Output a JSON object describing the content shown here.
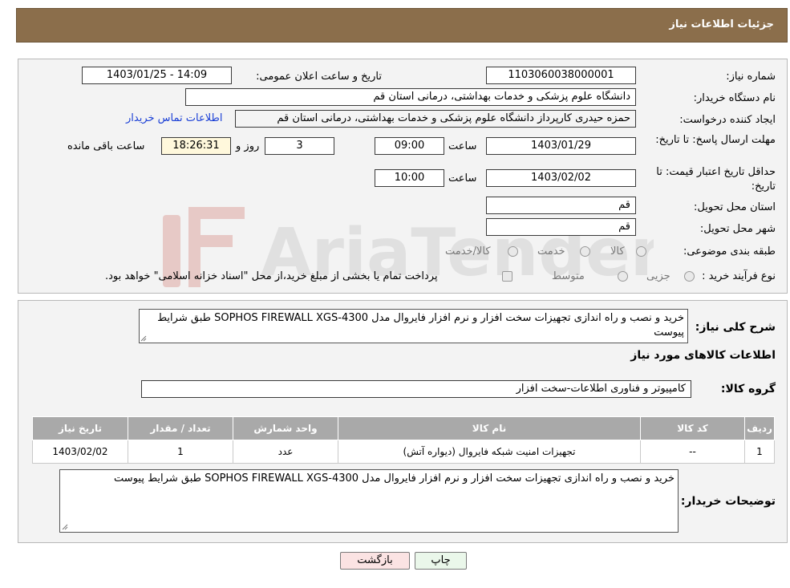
{
  "header": {
    "title": "جزئیات اطلاعات نیاز"
  },
  "fields": {
    "need_number_label": "شماره نیاز:",
    "need_number": "1103060038000001",
    "announce_label": "تاریخ و ساعت اعلان عمومی:",
    "announce_value": "1403/01/25 - 14:09",
    "buyer_org_label": "نام دستگاه خریدار:",
    "buyer_org": "دانشگاه علوم پزشکی و خدمات بهداشتی، درمانی استان قم",
    "creator_label": "ایجاد کننده درخواست:",
    "creator": "حمزه حیدری کارپرداز دانشگاه علوم پزشکی و خدمات بهداشتی، درمانی استان قم",
    "contact_link": "اطلاعات تماس خریدار",
    "deadline_label": "مهلت ارسال پاسخ: تا تاریخ:",
    "deadline_date": "1403/01/29",
    "time_label": "ساعت",
    "deadline_time": "09:00",
    "days_value": "3",
    "days_label": "روز و",
    "remaining_time": "18:26:31",
    "remaining_label": "ساعت باقی مانده",
    "validity_label": "حداقل تاریخ اعتبار قیمت: تا تاریخ:",
    "validity_date": "1403/02/02",
    "validity_time": "10:00",
    "province_label": "استان محل تحویل:",
    "province": "قم",
    "city_label": "شهر محل تحویل:",
    "city": "قم",
    "category_label": "طبقه بندی موضوعی:",
    "category_options": [
      "کالا",
      "خدمت",
      "کالا/خدمت"
    ],
    "process_label": "نوع فرآیند خرید :",
    "process_options": [
      "جزیی",
      "متوسط"
    ],
    "process_note": "پرداخت تمام یا بخشی از مبلغ خرید،از محل \"اسناد خزانه اسلامی\" خواهد بود."
  },
  "details": {
    "summary_label": "شرح کلی نیاز:",
    "summary": "خرید و نصب و راه اندازی تجهیزات سخت افزار و نرم افزار فایروال مدل SOPHOS FIREWALL XGS-4300 طبق شرایط پیوست",
    "goods_info_title": "اطلاعات کالاهای مورد نیاز",
    "goods_group_label": "گروه کالا:",
    "goods_group": "کامپیوتر و فناوری اطلاعات-سخت افزار",
    "table": {
      "headers": [
        "ردیف",
        "کد کالا",
        "نام کالا",
        "واحد شمارش",
        "تعداد / مقدار",
        "تاریخ نیاز"
      ],
      "rows": [
        [
          "1",
          "--",
          "تجهیزات امنیت شبکه فایروال (دیواره آتش)",
          "عدد",
          "1",
          "1403/02/02"
        ]
      ]
    },
    "buyer_notes_label": "توضیحات خریدار:",
    "buyer_notes": "خرید و نصب و راه اندازی تجهیزات سخت افزار و نرم افزار فایروال مدل SOPHOS FIREWALL XGS-4300 طبق شرایط پیوست"
  },
  "buttons": {
    "print": "چاپ",
    "back": "بازگشت"
  },
  "watermark": {
    "text": "AriaTender.neT"
  },
  "colors": {
    "header_bg": "#8b6e4b",
    "link": "#1a3fd6",
    "back_btn_bg": "#fbe3e3",
    "print_btn_bg": "#eaf7ea"
  }
}
